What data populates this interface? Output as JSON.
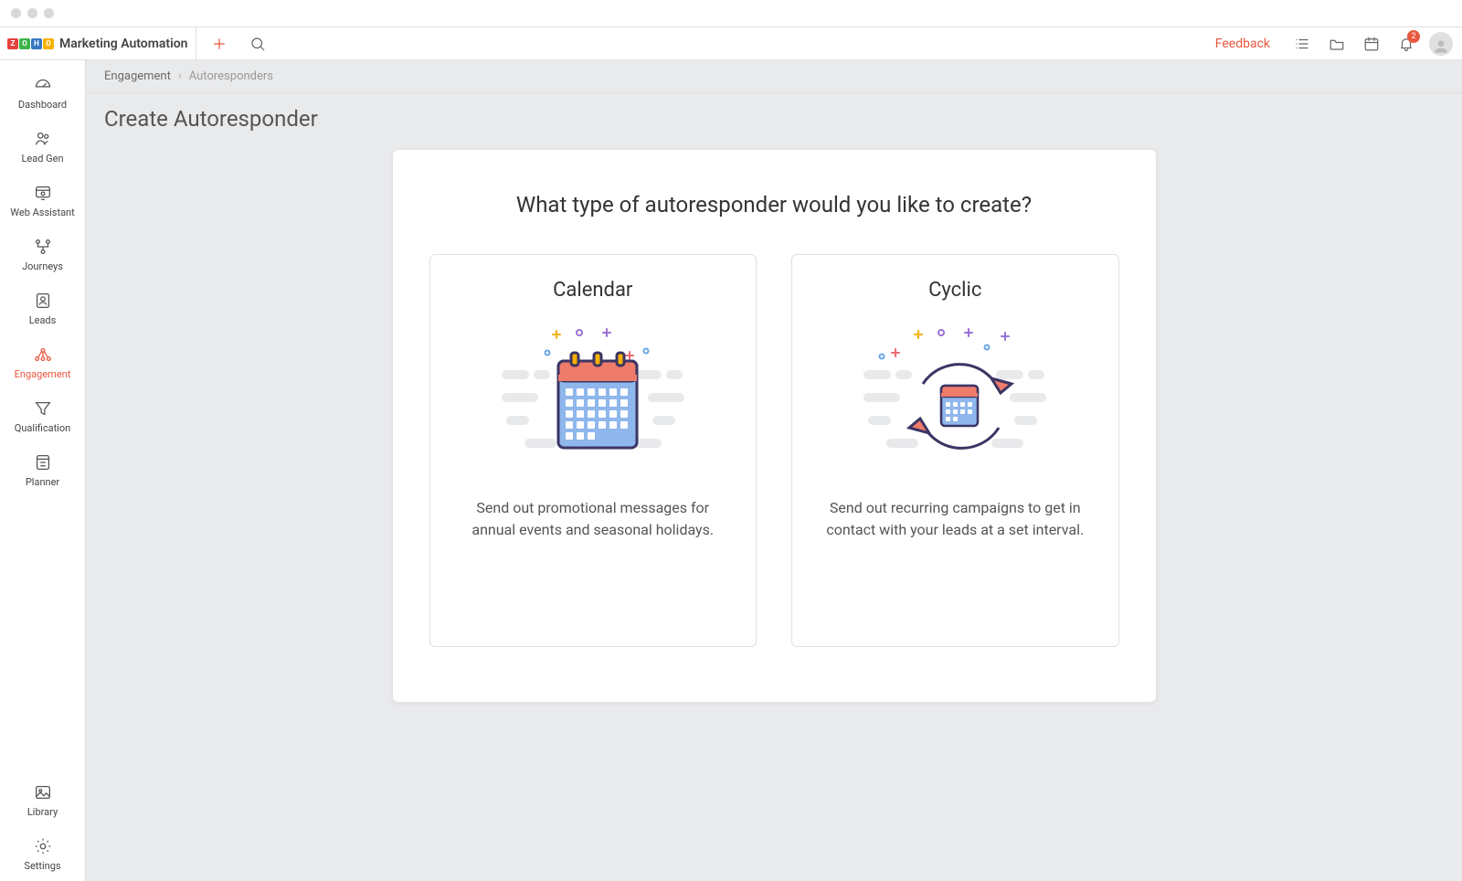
{
  "brand": {
    "name": "Marketing Automation"
  },
  "topbar": {
    "feedback_label": "Feedback",
    "notification_count": "2"
  },
  "sidebar": {
    "items": [
      {
        "label": "Dashboard",
        "icon": "gauge-icon"
      },
      {
        "label": "Lead Gen",
        "icon": "leadgen-icon"
      },
      {
        "label": "Web Assistant",
        "icon": "webassistant-icon"
      },
      {
        "label": "Journeys",
        "icon": "journeys-icon"
      },
      {
        "label": "Leads",
        "icon": "leads-icon"
      },
      {
        "label": "Engagement",
        "icon": "engagement-icon"
      },
      {
        "label": "Qualification",
        "icon": "funnel-icon"
      },
      {
        "label": "Planner",
        "icon": "planner-icon"
      }
    ],
    "bottom": [
      {
        "label": "Library",
        "icon": "library-icon"
      },
      {
        "label": "Settings",
        "icon": "gear-icon"
      }
    ]
  },
  "breadcrumb": {
    "parent": "Engagement",
    "current": "Autoresponders"
  },
  "page": {
    "title": "Create Autoresponder"
  },
  "panel": {
    "heading": "What type of autoresponder would you like to create?",
    "options": [
      {
        "title": "Calendar",
        "desc": "Send out promotional messages for annual events and seasonal holidays."
      },
      {
        "title": "Cyclic",
        "desc": "Send out recurring campaigns to get in contact with your leads at a set interval."
      }
    ]
  }
}
